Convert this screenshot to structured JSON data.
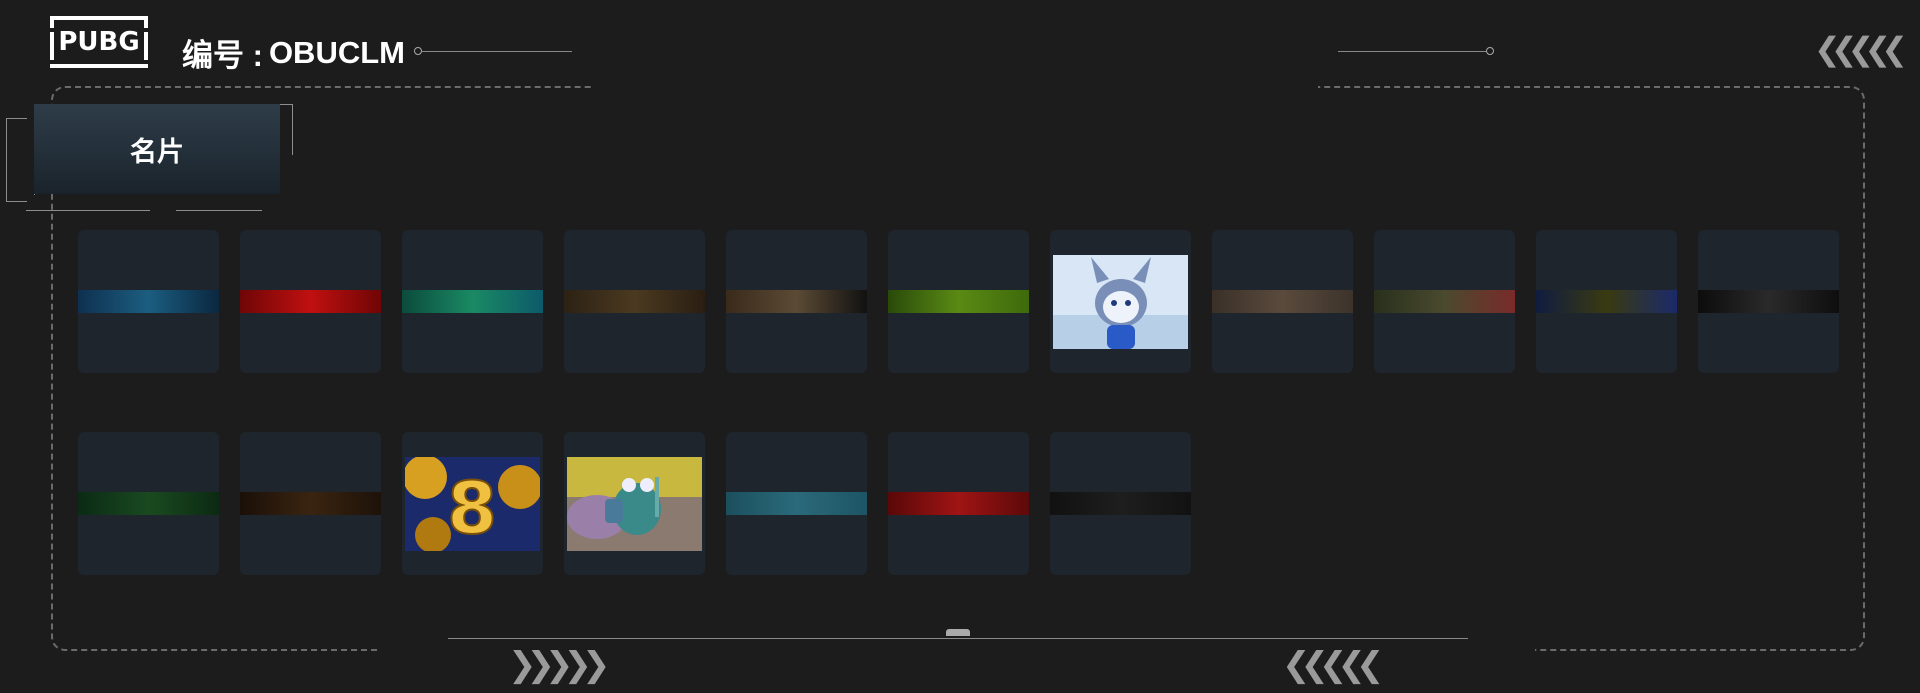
{
  "header": {
    "logo_text": "PUBG",
    "id_label": "编号 :",
    "id_value": "OBUCLM"
  },
  "section_tab": {
    "label": "名片"
  },
  "decor": {
    "left_chevrons": "❯❯❯❯❯",
    "right_chevrons": "❮❮❮❮❮",
    "top_right_chevrons": "❮❮❮❮❮"
  },
  "cards": [
    {
      "name": "blue-dark",
      "colors": [
        "#0f3050",
        "#1b5e80",
        "#0b2740"
      ]
    },
    {
      "name": "red",
      "colors": [
        "#6f0606",
        "#c01010",
        "#700505"
      ]
    },
    {
      "name": "green-teal",
      "colors": [
        "#0b4b3b",
        "#1a8a64",
        "#0d5a6a"
      ]
    },
    {
      "name": "brown-pattern",
      "colors": [
        "#2c2114",
        "#4b3a20",
        "#2a1e12"
      ]
    },
    {
      "name": "dark-brown-wing",
      "colors": [
        "#3a2a1a",
        "#5b4a34",
        "#111111"
      ]
    },
    {
      "name": "lime-mesh",
      "colors": [
        "#2a4a0a",
        "#5a8a14",
        "#3e6a0b"
      ]
    },
    {
      "name": "wolf-girl-art",
      "type": "image"
    },
    {
      "name": "tan-leather",
      "colors": [
        "#3a3028",
        "#5a4a3c",
        "#3c332b"
      ]
    },
    {
      "name": "shark-camo",
      "colors": [
        "#28301c",
        "#4a4a2e",
        "#7a2a2a"
      ]
    },
    {
      "name": "navy-yellow",
      "colors": [
        "#101c40",
        "#3a3a10",
        "#1a2a6a"
      ]
    },
    {
      "name": "black-tribal",
      "colors": [
        "#0c0c0c",
        "#2a2a2a",
        "#0e0e0e"
      ]
    },
    {
      "name": "jungle-eye",
      "colors": [
        "#0b2a14",
        "#1a4a20",
        "#0c2a12"
      ]
    },
    {
      "name": "tiger-brown",
      "colors": [
        "#1a1008",
        "#3a2410",
        "#1d1209"
      ]
    },
    {
      "name": "golden-eight",
      "type": "image"
    },
    {
      "name": "frog-knight",
      "type": "image"
    },
    {
      "name": "teal-polygon",
      "colors": [
        "#1c4f5e",
        "#2a6a7a",
        "#1d5565"
      ]
    },
    {
      "name": "red-diamonds",
      "colors": [
        "#5a0808",
        "#a01414",
        "#5d0909"
      ]
    },
    {
      "name": "black-dark",
      "colors": [
        "#111111",
        "#1e1e1e",
        "#121212"
      ]
    }
  ]
}
